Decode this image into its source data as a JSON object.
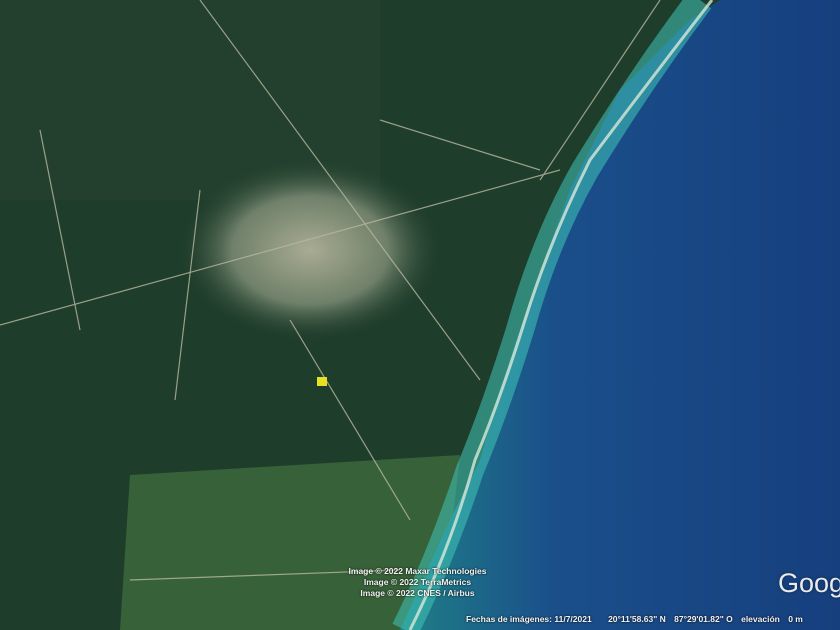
{
  "attribution": [
    "Image © 2022 Maxar Technologies",
    "Image © 2022 TerraMetrics",
    "Image © 2022 CNES / Airbus"
  ],
  "status": {
    "imagery_date": "Fechas de imágenes: 11/7/2021",
    "latitude": "20°11'58.63\" N",
    "longitude": "87°29'01.82\" O",
    "elevation": "elevación",
    "elevation_value": "0 m"
  },
  "logo": "Goog",
  "colors": {
    "land": "#1f3d2b",
    "sea_deep": "#123a7a",
    "sea_shallow": "#2aa39a",
    "marker": "#e8e020"
  }
}
